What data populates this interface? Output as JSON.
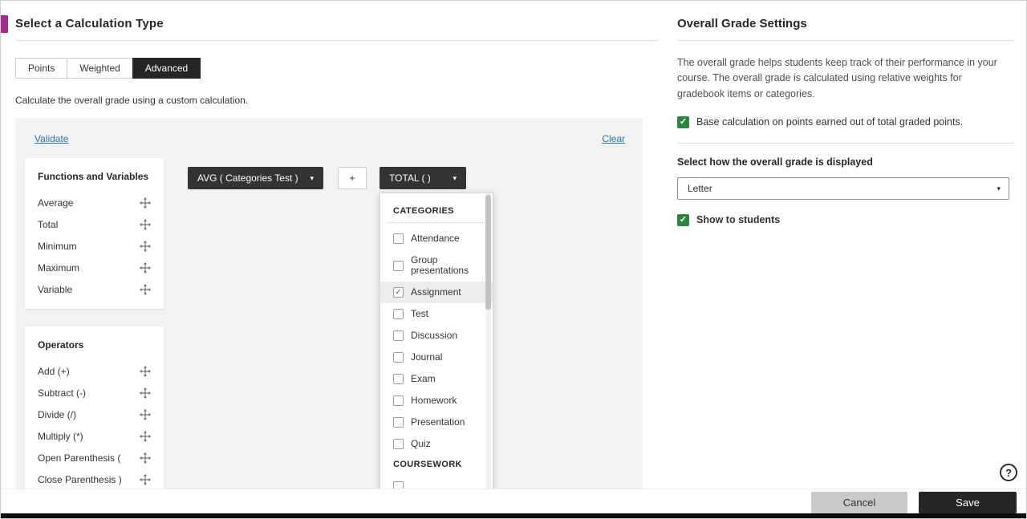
{
  "colors": {
    "accent_purple": "#a32b8c",
    "check_green": "#2e8540",
    "link_blue": "#2b72a8",
    "chip_dark": "#333333"
  },
  "left": {
    "title": "Select a Calculation Type",
    "tabs": [
      {
        "label": "Points"
      },
      {
        "label": "Weighted"
      },
      {
        "label": "Advanced"
      }
    ],
    "description": "Calculate the overall grade using a custom calculation.",
    "validate_label": "Validate",
    "clear_label": "Clear",
    "functions": {
      "title": "Functions and Variables",
      "items": [
        "Average",
        "Total",
        "Minimum",
        "Maximum",
        "Variable"
      ]
    },
    "operators": {
      "title": "Operators",
      "items": [
        "Add (+)",
        "Subtract (-)",
        "Divide (/)",
        "Multiply (*)",
        "Open Parenthesis (",
        "Close Parenthesis )"
      ]
    },
    "expression": {
      "avg_chip": "AVG ( Categories Test )",
      "plus_chip": "+",
      "total_chip": "TOTAL ( )"
    },
    "dropdown": {
      "categories_header": "CATEGORIES",
      "coursework_header": "COURSEWORK",
      "items": [
        {
          "label": "Attendance",
          "checked": false
        },
        {
          "label": "Group presentations",
          "checked": false
        },
        {
          "label": "Assignment",
          "checked": true
        },
        {
          "label": "Test",
          "checked": false
        },
        {
          "label": "Discussion",
          "checked": false
        },
        {
          "label": "Journal",
          "checked": false
        },
        {
          "label": "Exam",
          "checked": false
        },
        {
          "label": "Homework",
          "checked": false
        },
        {
          "label": "Presentation",
          "checked": false
        },
        {
          "label": "Quiz",
          "checked": false
        }
      ]
    }
  },
  "right": {
    "title": "Overall Grade Settings",
    "description": "The overall grade helps students keep track of their performance in your course. The overall grade is calculated using relative weights for gradebook items or categories.",
    "base_calculation_label": "Base calculation on points earned out of total graded points.",
    "display_question": "Select how the overall grade is displayed",
    "display_value": "Letter",
    "show_to_students_label": "Show to students"
  },
  "footer": {
    "cancel_label": "Cancel",
    "save_label": "Save"
  },
  "help_label": "?"
}
